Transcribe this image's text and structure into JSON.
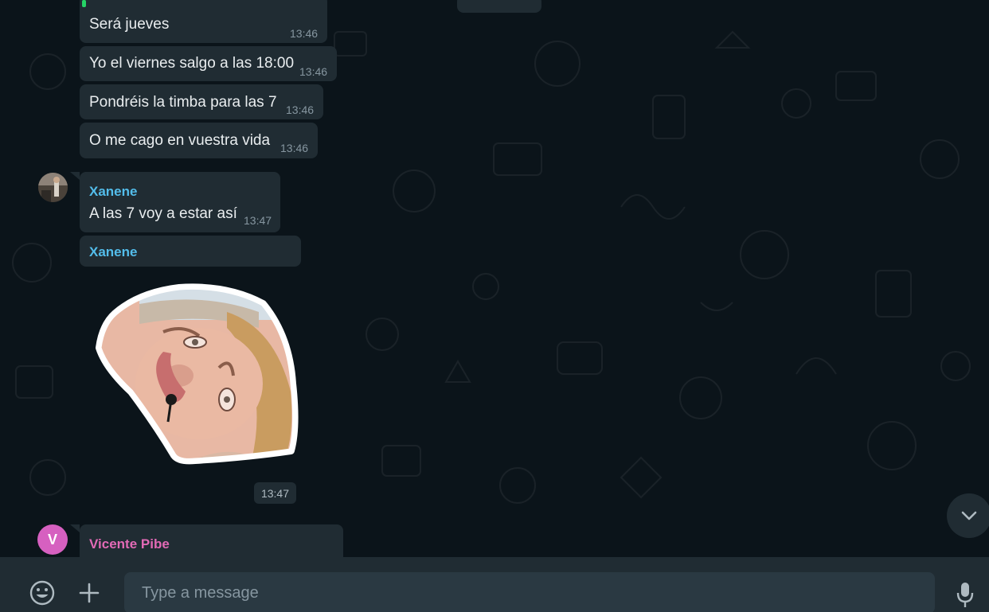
{
  "messages": [
    {
      "text": "Será jueves",
      "time": "13:46"
    },
    {
      "text": "Yo el viernes salgo a las 18:00",
      "time": "13:46"
    },
    {
      "text": "Pondréis la timba para las 7",
      "time": "13:46"
    },
    {
      "text": "O me cago en vuestra vida",
      "time": "13:46"
    },
    {
      "sender": "Xanene",
      "text": "A las 7 voy a estar así",
      "time": "13:47"
    },
    {
      "sender": "Xanene",
      "time": "13:47"
    },
    {
      "sender": "Vicente Pibe",
      "avatar_initial": "V"
    }
  ],
  "composer": {
    "placeholder": "Type a message",
    "icons": [
      "emoji-icon",
      "plus-icon",
      "microphone-icon"
    ]
  },
  "colors": {
    "background": "#0b141a",
    "bubble": "#202c33",
    "sender_xanene": "#53bdeb",
    "sender_vicente": "#e26ab6",
    "avatar_vicente": "#d660c0"
  }
}
